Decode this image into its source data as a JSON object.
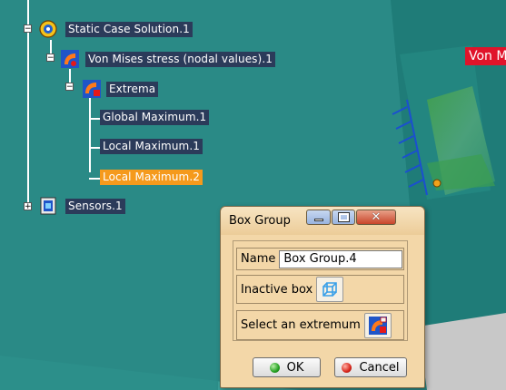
{
  "tree": {
    "items": [
      {
        "label": "Static Case Solution.1",
        "icon": "static-case-solution-icon"
      },
      {
        "label": "Von Mises stress (nodal values).1",
        "icon": "von-mises-stress-icon"
      },
      {
        "label": "Extrema",
        "icon": "extrema-icon"
      },
      {
        "label": "Global Maximum.1"
      },
      {
        "label": "Local Maximum.1"
      },
      {
        "label": "Local Maximum.2",
        "selected": true
      },
      {
        "label": "Sensors.1",
        "icon": "sensors-icon"
      }
    ]
  },
  "viewport": {
    "image_label": "Von Mises",
    "colors": {
      "background": "#2f8f8a",
      "selection": "#f59a1c",
      "tree_label_bg": "#2b3b5a"
    }
  },
  "dialog": {
    "title": "Box Group",
    "name_label": "Name",
    "name_value": "Box Group.4",
    "inactive_box_label": "Inactive box",
    "select_extremum_label": "Select an extremum",
    "ok_label": "OK",
    "cancel_label": "Cancel",
    "close_glyph": "✕"
  }
}
